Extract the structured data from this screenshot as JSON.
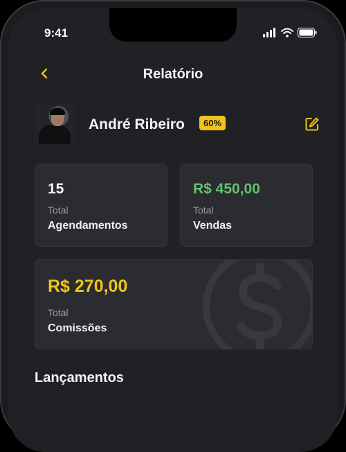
{
  "status_bar": {
    "time": "9:41"
  },
  "header": {
    "title": "Relatório"
  },
  "profile": {
    "name": "André Ribeiro",
    "commission_badge": "60%"
  },
  "stats": {
    "appointments": {
      "value": "15",
      "label_top": "Total",
      "label_bottom": "Agendamentos"
    },
    "sales": {
      "value": "R$ 450,00",
      "label_top": "Total",
      "label_bottom": "Vendas"
    },
    "commissions": {
      "value": "R$ 270,00",
      "label_top": "Total",
      "label_bottom": "Comissões"
    }
  },
  "sections": {
    "entries_title": "Lançamentos"
  },
  "colors": {
    "accent": "#f0c419",
    "positive": "#62c36c",
    "background": "#1f2125",
    "card": "#2a2c31"
  },
  "icons": [
    "back-chevron-icon",
    "signal-icon",
    "wifi-icon",
    "battery-icon",
    "edit-icon",
    "dollar-icon"
  ]
}
